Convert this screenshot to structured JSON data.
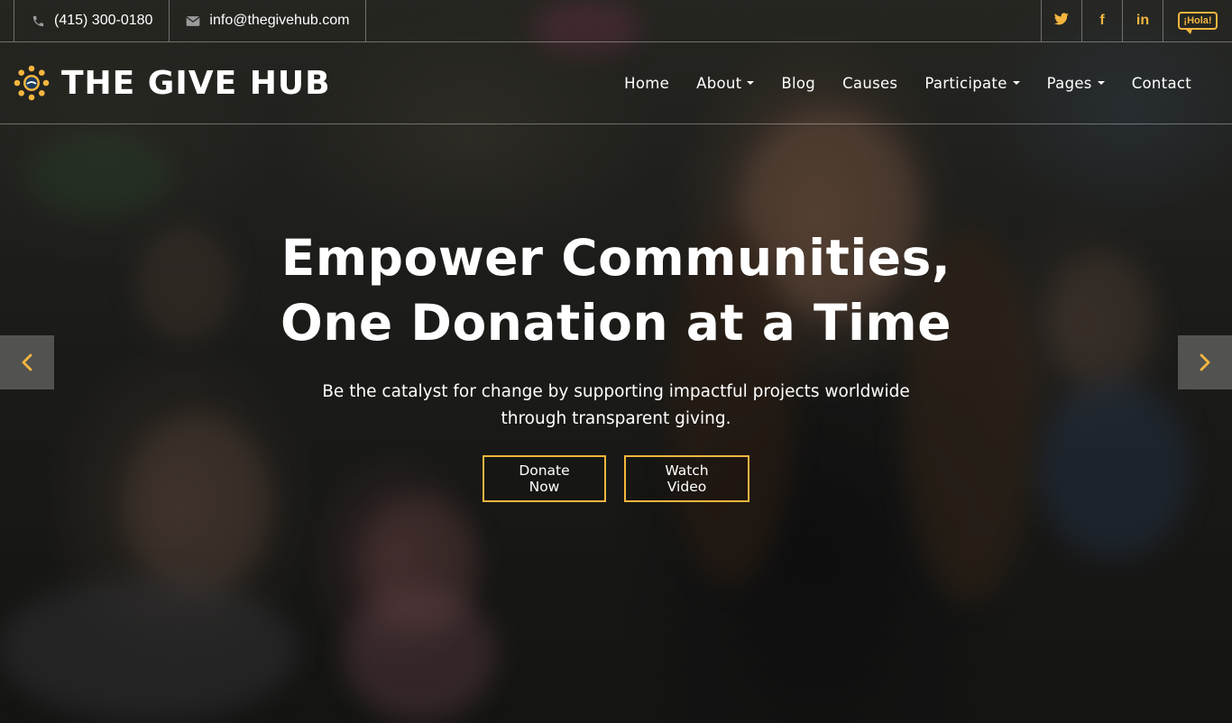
{
  "topbar": {
    "phone": "(415) 300-0180",
    "email": "info@thegivehub.com",
    "social": [
      {
        "icon": "twitter-icon",
        "glyph": ""
      },
      {
        "icon": "facebook-icon",
        "glyph": "f"
      },
      {
        "icon": "linkedin-icon",
        "glyph": "in"
      }
    ],
    "language_badge": "¡Hola!"
  },
  "brand": {
    "name": "THE GIVE HUB"
  },
  "nav": {
    "items": [
      {
        "label": "Home",
        "dropdown": false
      },
      {
        "label": "About",
        "dropdown": true
      },
      {
        "label": "Blog",
        "dropdown": false
      },
      {
        "label": "Causes",
        "dropdown": false
      },
      {
        "label": "Participate",
        "dropdown": true
      },
      {
        "label": "Pages",
        "dropdown": true
      },
      {
        "label": "Contact",
        "dropdown": false
      }
    ]
  },
  "hero": {
    "title_line1": "Empower Communities,",
    "title_line2": "One Donation at a Time",
    "subtitle": "Be the catalyst for change by supporting impactful projects worldwide through transparent giving.",
    "primary_button": "Donate Now",
    "secondary_button": "Watch Video"
  },
  "colors": {
    "accent": "#f4b63f",
    "text": "#ffffff",
    "icon_muted": "#9a9a9a"
  }
}
